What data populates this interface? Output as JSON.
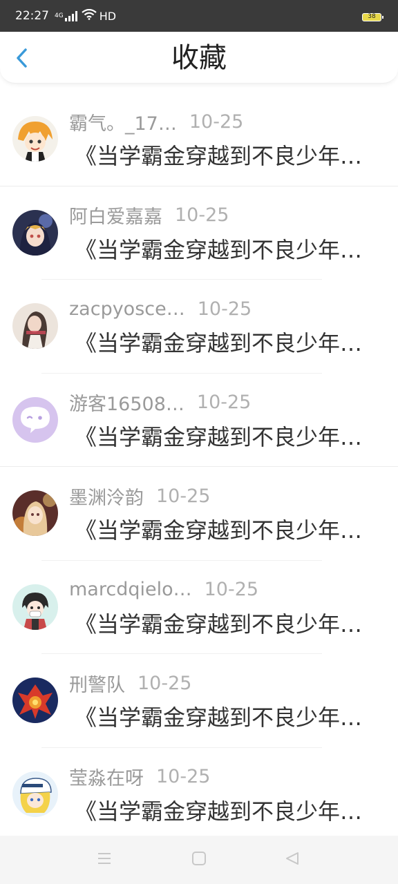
{
  "status_bar": {
    "time": "22:27",
    "signal_label": "4G",
    "network_label": "HD",
    "battery": "38"
  },
  "header": {
    "title": "收藏",
    "back_icon": "chevron-left-icon"
  },
  "colors": {
    "accent": "#3a9ad9",
    "status_bar_bg": "#3a3a3a",
    "meta_text": "#9a9a9a",
    "book_text": "#333333"
  },
  "favorites": [
    {
      "user": "霸气。_17…",
      "date": "10-25",
      "book": "《当学霸金穿越到不良少年…",
      "avatar": "anime-orange-hair-avatar"
    },
    {
      "user": "阿白爱嘉嘉",
      "date": "10-25",
      "book": "《当学霸金穿越到不良少年…",
      "avatar": "anime-dark-blue-avatar"
    },
    {
      "user": "zacpyosce…",
      "date": "10-25",
      "book": "《当学霸金穿越到不良少年…",
      "avatar": "girl-photo-avatar"
    },
    {
      "user": "游客16508…",
      "date": "10-25",
      "book": "《当学霸金穿越到不良少年…",
      "avatar": "default-chat-bubble-avatar"
    },
    {
      "user": "墨渊泠韵",
      "date": "10-25",
      "book": "《当学霸金穿越到不良少年…",
      "avatar": "anime-warm-light-avatar"
    },
    {
      "user": "marcdqielo…",
      "date": "10-25",
      "book": "《当学霸金穿越到不良少年…",
      "avatar": "anime-mask-avatar"
    },
    {
      "user": "刑警队",
      "date": "10-25",
      "book": "《当学霸金穿越到不良少年…",
      "avatar": "red-phoenix-avatar"
    },
    {
      "user": "莹淼在呀",
      "date": "10-25",
      "book": "《当学霸金穿越到不良少年…",
      "avatar": "anime-white-cap-avatar"
    }
  ],
  "nav_bar": {
    "menu_icon": "menu-icon",
    "home_icon": "home-square-icon",
    "back_icon": "back-triangle-icon"
  }
}
